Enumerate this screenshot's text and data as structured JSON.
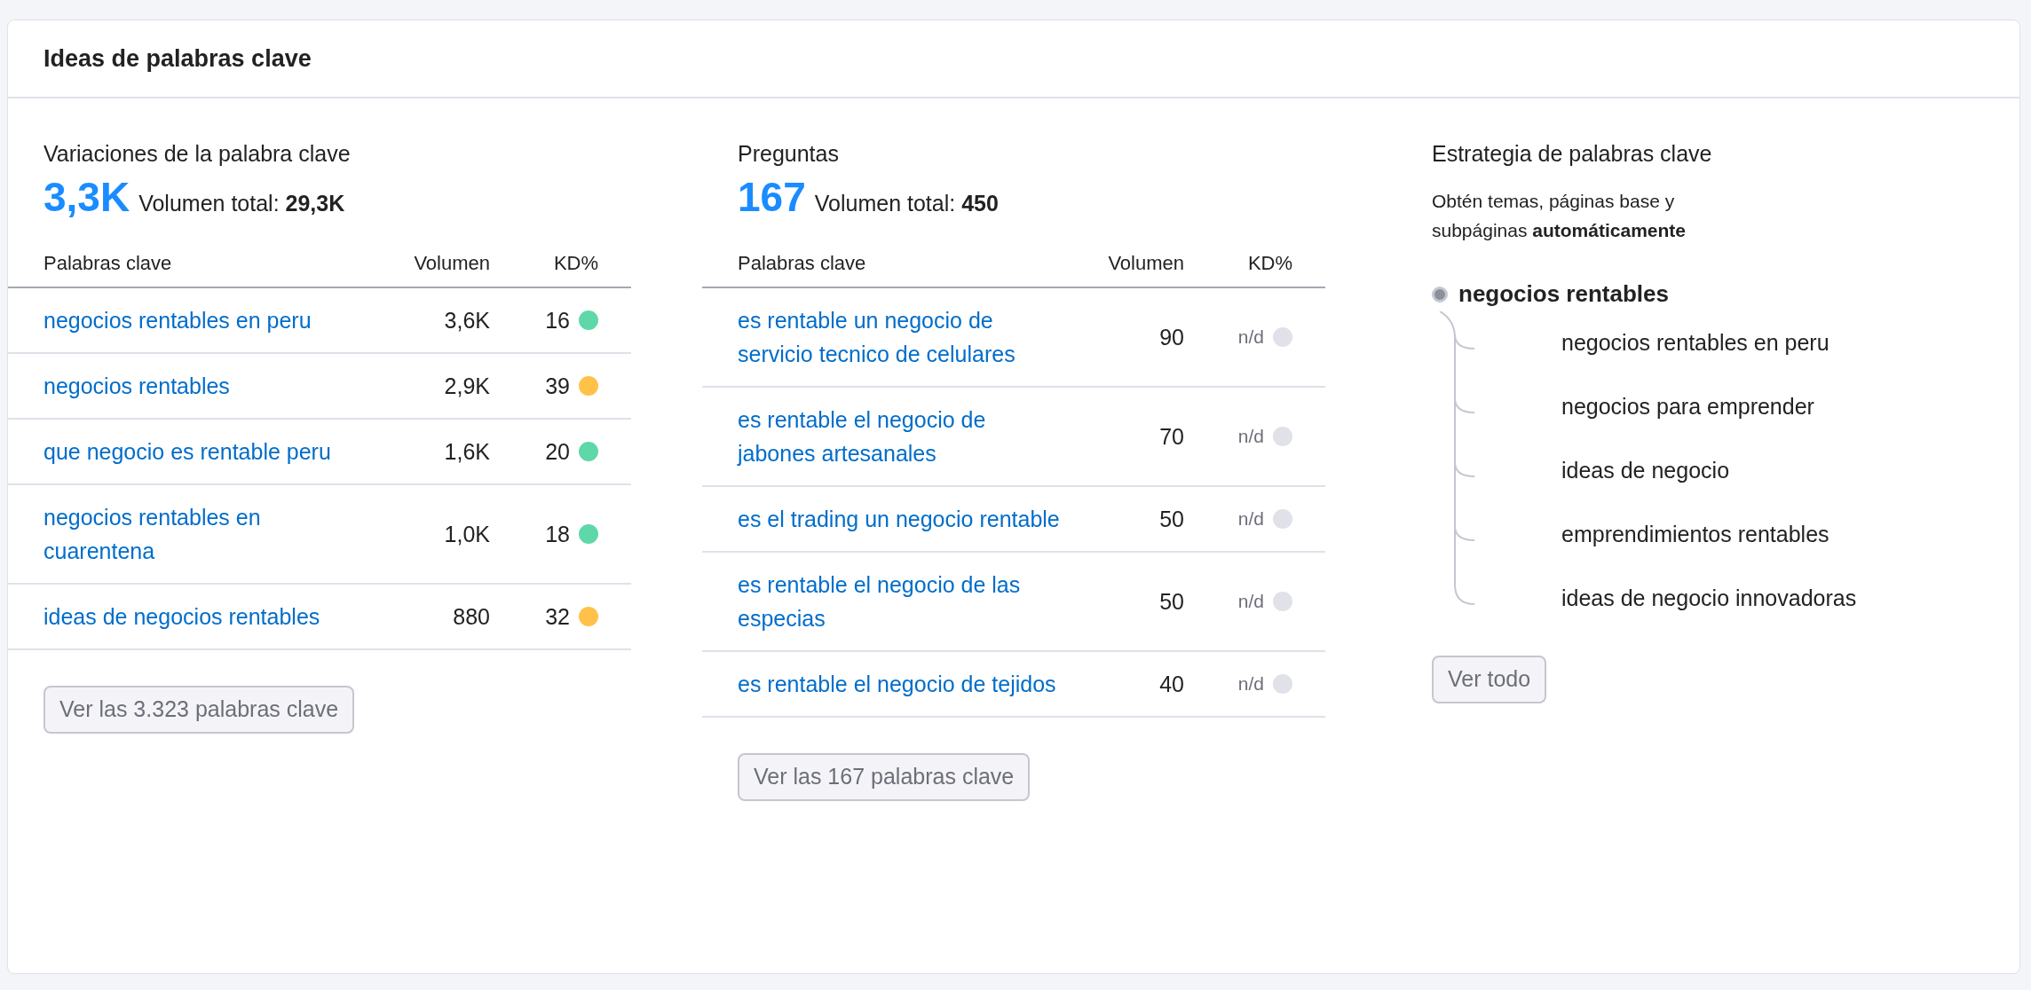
{
  "card": {
    "title": "Ideas de palabras clave"
  },
  "variations": {
    "title": "Variaciones de la palabra clave",
    "count": "3,3K",
    "total_label": "Volumen total:",
    "total": "29,3K",
    "columns": [
      "Palabras clave",
      "Volumen",
      "KD%"
    ],
    "rows": [
      {
        "keyword": "negocios rentables en peru",
        "volume": "3,6K",
        "kd": "16",
        "color": "#5ed8a8"
      },
      {
        "keyword": "negocios rentables",
        "volume": "2,9K",
        "kd": "39",
        "color": "#ffc148"
      },
      {
        "keyword": "que negocio es rentable peru",
        "volume": "1,6K",
        "kd": "20",
        "color": "#5ed8a8"
      },
      {
        "keyword": "negocios rentables en cuarentena",
        "volume": "1,0K",
        "kd": "18",
        "color": "#5ed8a8"
      },
      {
        "keyword": "ideas de negocios rentables",
        "volume": "880",
        "kd": "32",
        "color": "#ffc148"
      }
    ],
    "button": "Ver las 3.323 palabras clave"
  },
  "questions": {
    "title": "Preguntas",
    "count": "167",
    "total_label": "Volumen total:",
    "total": "450",
    "columns": [
      "Palabras clave",
      "Volumen",
      "KD%"
    ],
    "rows": [
      {
        "keyword": "es rentable un negocio de servicio tecnico de celulares",
        "volume": "90",
        "kd": "n/d",
        "color": "#e0e1e9"
      },
      {
        "keyword": "es rentable el negocio de jabones artesanales",
        "volume": "70",
        "kd": "n/d",
        "color": "#e0e1e9"
      },
      {
        "keyword": "es el trading un negocio rentable",
        "volume": "50",
        "kd": "n/d",
        "color": "#e0e1e9"
      },
      {
        "keyword": "es rentable el negocio de las especias",
        "volume": "50",
        "kd": "n/d",
        "color": "#e0e1e9"
      },
      {
        "keyword": "es rentable el negocio de tejidos",
        "volume": "40",
        "kd": "n/d",
        "color": "#e0e1e9"
      }
    ],
    "button": "Ver las 167 palabras clave"
  },
  "strategy": {
    "title": "Estrategia de palabras clave",
    "description": "Obtén temas, páginas base y subpáginas **automáticamente**",
    "tree": {
      "label": "negocios rentables",
      "children": [
        {
          "label": "negocios rentables en peru"
        },
        {
          "label": "negocios para emprender"
        },
        {
          "label": "ideas de negocio"
        },
        {
          "label": "emprendimientos rentables"
        },
        {
          "label": "ideas de negocio innovadoras"
        }
      ]
    },
    "button": "Ver todo"
  }
}
